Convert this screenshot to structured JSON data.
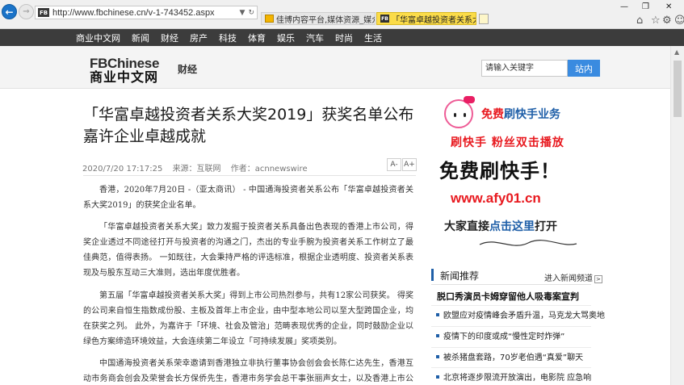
{
  "browser": {
    "url": "http://www.fbchinese.cn/v-1-743452.aspx",
    "favicon_text": "FB",
    "tabs": [
      {
        "label": "佳博内容平台,媒体资源_媒介资..."
      },
      {
        "label": "「华富卓越投资者关系大奖2...",
        "active": true
      }
    ]
  },
  "sitenav": {
    "items": [
      "商业中文网",
      "新闻",
      "财经",
      "房产",
      "科技",
      "体育",
      "娱乐",
      "汽车",
      "时尚",
      "生活"
    ]
  },
  "header": {
    "logo_en": "FBChinese",
    "logo_cn": "商业中文网",
    "section": "财经",
    "search_placeholder": "请输入关键字",
    "search_button": "站内"
  },
  "article": {
    "title": "「华富卓越投资者关系大奖2019」获奖名单公布嘉许企业卓越成就",
    "date": "2020/7/20 17:17:25",
    "source": "来源：互联网",
    "author": "作者：acnnewswire",
    "font_smaller": "A-",
    "font_larger": "A+",
    "paragraphs": [
      "香港，2020年7月20日 -（亚太商讯） - 中国通海投资者关系公布「华富卓越投资者关系大奖2019」的获奖企业名单。",
      "「华富卓越投资者关系大奖」致力发掘于投资者关系具备出色表现的香港上市公司，得奖企业透过不同途径打开与投资者的沟通之门，杰出的专业手腕为投资者关系工作树立了最佳典范，值得表扬。 一如既往，大会秉持严格的评选标准，根据企业透明度、投资者关系表现及与股东互动三大准则，选出年度优胜者。",
      "第五届「华富卓越投资者关系大奖」得到上市公司热烈参与，共有12家公司获奖。 得奖的公司来自恒生指数成份股、主板及首年上市企业，由中型本地公司以至大型跨国企业，均在获奖之列。 此外，为嘉许于「环境、社会及管治」范畴表现优秀的企业，同时鼓励企业以绿色方案缔造环境效益，大会连续第二年设立「可持续发展」奖项类别。",
      "中国通海投资者关系荣幸邀请到香港独立非执行董事协会创会会长陈仁达先生，香港互动市务商会创会及荣誉会长方保侨先生，香港市务学会总干事张丽声女士，以及香港上市公司商"
    ]
  },
  "ad": {
    "line1_red": "免费",
    "line1_rest": "刷快手业务",
    "line2": "刷快手 粉丝双击播放",
    "line3": "免费刷快手！",
    "line4": "www.afy01.cn",
    "line5_a": "大家直接",
    "line5_b": "点击这里",
    "line5_c": "打开"
  },
  "news": {
    "title": "新闻推荐",
    "more": "进入新闻频道",
    "headline": "脱口秀演员卡姆穿留他人吸毒案宣判",
    "items": [
      "欧盟应对疫情峰会矛盾升温，马克龙大骂奥地",
      "疫情下的印度或成“慢性定时炸弹”",
      "被杀猪盘套路，70岁老伯遇“真爱”聊天",
      "北京将逐步限流开放演出，电影院 应急响"
    ]
  },
  "colors": {
    "nav_bg": "#3c3c3c",
    "accent_blue": "#3a8be0",
    "ad_red": "#e8191f",
    "tab_active": "#fbdc49"
  }
}
